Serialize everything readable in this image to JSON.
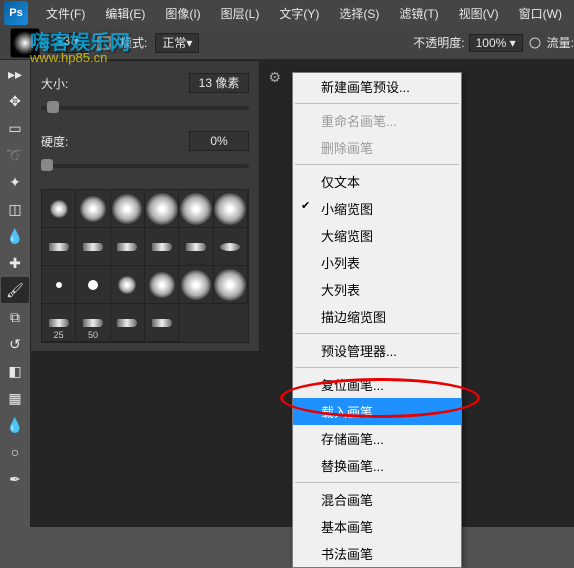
{
  "menubar": {
    "items": [
      "文件(F)",
      "编辑(E)",
      "图像(I)",
      "图层(L)",
      "文字(Y)",
      "选择(S)",
      "滤镜(T)",
      "视图(V)",
      "窗口(W)"
    ]
  },
  "optionbar": {
    "brush_size": "13",
    "mode_label": "模式:",
    "mode_value": "正常",
    "opacity_label": "不透明度:",
    "opacity_value": "100%",
    "flow_label": "流量:"
  },
  "watermark": {
    "t1": "嗨客娱乐网",
    "t2": "www.hp85.cn"
  },
  "brush_panel": {
    "size_label": "大小:",
    "size_value": "13 像素",
    "hardness_label": "硬度:",
    "hardness_value": "0%",
    "preset_sizes": [
      "",
      "",
      "",
      "",
      "",
      "",
      "",
      "",
      "",
      "",
      "",
      "",
      "",
      "",
      "",
      "",
      "",
      "",
      "25",
      "50",
      "",
      ""
    ]
  },
  "context_menu": {
    "items": [
      {
        "label": "新建画笔预设...",
        "type": "item"
      },
      {
        "type": "sep"
      },
      {
        "label": "重命名画笔...",
        "type": "disabled"
      },
      {
        "label": "删除画笔",
        "type": "disabled"
      },
      {
        "type": "sep"
      },
      {
        "label": "仅文本",
        "type": "item"
      },
      {
        "label": "小缩览图",
        "type": "check"
      },
      {
        "label": "大缩览图",
        "type": "item"
      },
      {
        "label": "小列表",
        "type": "item"
      },
      {
        "label": "大列表",
        "type": "item"
      },
      {
        "label": "描边缩览图",
        "type": "item"
      },
      {
        "type": "sep"
      },
      {
        "label": "预设管理器...",
        "type": "item"
      },
      {
        "type": "sep"
      },
      {
        "label": "复位画笔...",
        "type": "item"
      },
      {
        "label": "载入画笔...",
        "type": "selected"
      },
      {
        "label": "存储画笔...",
        "type": "item"
      },
      {
        "label": "替换画笔...",
        "type": "item"
      },
      {
        "type": "sep"
      },
      {
        "label": "混合画笔",
        "type": "item"
      },
      {
        "label": "基本画笔",
        "type": "item"
      },
      {
        "label": "书法画笔",
        "type": "item"
      }
    ]
  }
}
